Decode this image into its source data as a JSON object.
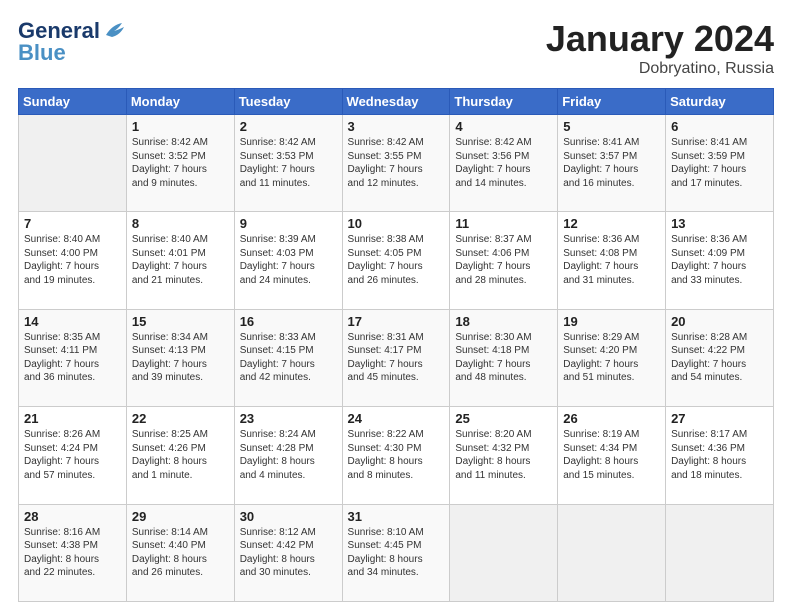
{
  "header": {
    "logo_line1": "General",
    "logo_line2": "Blue",
    "title": "January 2024",
    "location": "Dobryatino, Russia"
  },
  "days_of_week": [
    "Sunday",
    "Monday",
    "Tuesday",
    "Wednesday",
    "Thursday",
    "Friday",
    "Saturday"
  ],
  "weeks": [
    [
      {
        "day": "",
        "info": ""
      },
      {
        "day": "1",
        "info": "Sunrise: 8:42 AM\nSunset: 3:52 PM\nDaylight: 7 hours\nand 9 minutes."
      },
      {
        "day": "2",
        "info": "Sunrise: 8:42 AM\nSunset: 3:53 PM\nDaylight: 7 hours\nand 11 minutes."
      },
      {
        "day": "3",
        "info": "Sunrise: 8:42 AM\nSunset: 3:55 PM\nDaylight: 7 hours\nand 12 minutes."
      },
      {
        "day": "4",
        "info": "Sunrise: 8:42 AM\nSunset: 3:56 PM\nDaylight: 7 hours\nand 14 minutes."
      },
      {
        "day": "5",
        "info": "Sunrise: 8:41 AM\nSunset: 3:57 PM\nDaylight: 7 hours\nand 16 minutes."
      },
      {
        "day": "6",
        "info": "Sunrise: 8:41 AM\nSunset: 3:59 PM\nDaylight: 7 hours\nand 17 minutes."
      }
    ],
    [
      {
        "day": "7",
        "info": "Sunrise: 8:40 AM\nSunset: 4:00 PM\nDaylight: 7 hours\nand 19 minutes."
      },
      {
        "day": "8",
        "info": "Sunrise: 8:40 AM\nSunset: 4:01 PM\nDaylight: 7 hours\nand 21 minutes."
      },
      {
        "day": "9",
        "info": "Sunrise: 8:39 AM\nSunset: 4:03 PM\nDaylight: 7 hours\nand 24 minutes."
      },
      {
        "day": "10",
        "info": "Sunrise: 8:38 AM\nSunset: 4:05 PM\nDaylight: 7 hours\nand 26 minutes."
      },
      {
        "day": "11",
        "info": "Sunrise: 8:37 AM\nSunset: 4:06 PM\nDaylight: 7 hours\nand 28 minutes."
      },
      {
        "day": "12",
        "info": "Sunrise: 8:36 AM\nSunset: 4:08 PM\nDaylight: 7 hours\nand 31 minutes."
      },
      {
        "day": "13",
        "info": "Sunrise: 8:36 AM\nSunset: 4:09 PM\nDaylight: 7 hours\nand 33 minutes."
      }
    ],
    [
      {
        "day": "14",
        "info": "Sunrise: 8:35 AM\nSunset: 4:11 PM\nDaylight: 7 hours\nand 36 minutes."
      },
      {
        "day": "15",
        "info": "Sunrise: 8:34 AM\nSunset: 4:13 PM\nDaylight: 7 hours\nand 39 minutes."
      },
      {
        "day": "16",
        "info": "Sunrise: 8:33 AM\nSunset: 4:15 PM\nDaylight: 7 hours\nand 42 minutes."
      },
      {
        "day": "17",
        "info": "Sunrise: 8:31 AM\nSunset: 4:17 PM\nDaylight: 7 hours\nand 45 minutes."
      },
      {
        "day": "18",
        "info": "Sunrise: 8:30 AM\nSunset: 4:18 PM\nDaylight: 7 hours\nand 48 minutes."
      },
      {
        "day": "19",
        "info": "Sunrise: 8:29 AM\nSunset: 4:20 PM\nDaylight: 7 hours\nand 51 minutes."
      },
      {
        "day": "20",
        "info": "Sunrise: 8:28 AM\nSunset: 4:22 PM\nDaylight: 7 hours\nand 54 minutes."
      }
    ],
    [
      {
        "day": "21",
        "info": "Sunrise: 8:26 AM\nSunset: 4:24 PM\nDaylight: 7 hours\nand 57 minutes."
      },
      {
        "day": "22",
        "info": "Sunrise: 8:25 AM\nSunset: 4:26 PM\nDaylight: 8 hours\nand 1 minute."
      },
      {
        "day": "23",
        "info": "Sunrise: 8:24 AM\nSunset: 4:28 PM\nDaylight: 8 hours\nand 4 minutes."
      },
      {
        "day": "24",
        "info": "Sunrise: 8:22 AM\nSunset: 4:30 PM\nDaylight: 8 hours\nand 8 minutes."
      },
      {
        "day": "25",
        "info": "Sunrise: 8:20 AM\nSunset: 4:32 PM\nDaylight: 8 hours\nand 11 minutes."
      },
      {
        "day": "26",
        "info": "Sunrise: 8:19 AM\nSunset: 4:34 PM\nDaylight: 8 hours\nand 15 minutes."
      },
      {
        "day": "27",
        "info": "Sunrise: 8:17 AM\nSunset: 4:36 PM\nDaylight: 8 hours\nand 18 minutes."
      }
    ],
    [
      {
        "day": "28",
        "info": "Sunrise: 8:16 AM\nSunset: 4:38 PM\nDaylight: 8 hours\nand 22 minutes."
      },
      {
        "day": "29",
        "info": "Sunrise: 8:14 AM\nSunset: 4:40 PM\nDaylight: 8 hours\nand 26 minutes."
      },
      {
        "day": "30",
        "info": "Sunrise: 8:12 AM\nSunset: 4:42 PM\nDaylight: 8 hours\nand 30 minutes."
      },
      {
        "day": "31",
        "info": "Sunrise: 8:10 AM\nSunset: 4:45 PM\nDaylight: 8 hours\nand 34 minutes."
      },
      {
        "day": "",
        "info": ""
      },
      {
        "day": "",
        "info": ""
      },
      {
        "day": "",
        "info": ""
      }
    ]
  ]
}
